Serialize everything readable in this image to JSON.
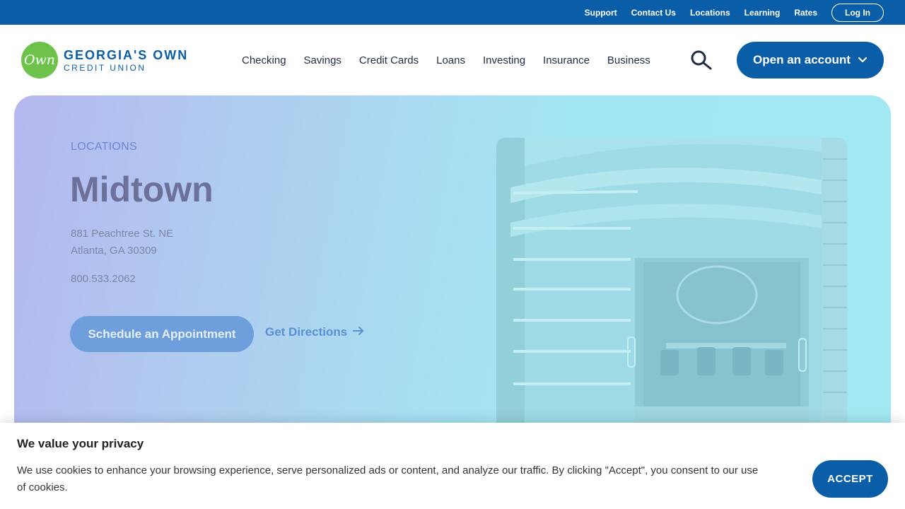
{
  "utility_nav": {
    "links": [
      "Support",
      "Contact Us",
      "Locations",
      "Learning",
      "Rates"
    ],
    "login_label": "Log In"
  },
  "brand": {
    "logo_mark": "Own",
    "name_line1": "GEORGIA'S OWN",
    "name_line2": "CREDIT UNION"
  },
  "main_nav": {
    "items": [
      "Checking",
      "Savings",
      "Credit Cards",
      "Loans",
      "Investing",
      "Insurance",
      "Business"
    ],
    "search_icon": "search-icon",
    "cta_label": "Open an account"
  },
  "hero": {
    "eyebrow": "LOCATIONS",
    "title": "Midtown",
    "address_line1": "881 Peachtree St. NE",
    "address_line2": "Atlanta, GA 30309",
    "phone": "800.533.2062",
    "schedule_label": "Schedule an Appointment",
    "directions_label": "Get Directions"
  },
  "cookie": {
    "title": "We value your privacy",
    "body": "We use cookies to enhance your browsing experience, serve personalized ads or content, and analyze our traffic. By clicking \"Accept\", you consent to our use of cookies.",
    "accept_label": "ACCEPT"
  },
  "colors": {
    "brand_blue": "#0a5da7",
    "brand_green": "#6cc24a",
    "nav_text": "#1f2a44"
  }
}
